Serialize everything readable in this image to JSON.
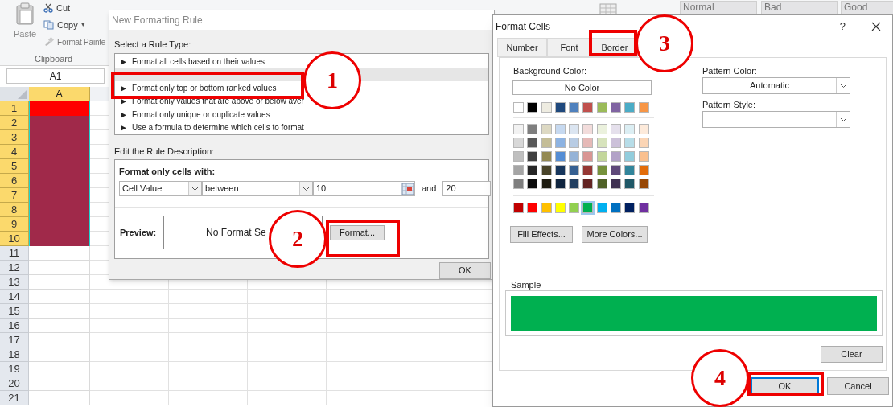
{
  "spreadsheet": {
    "ribbon": {
      "paste": "Paste",
      "cut": "Cut",
      "copy": "Copy",
      "copy_caret": "▾",
      "format_painter": "Format Painte",
      "group_label": "Clipboard",
      "styles": [
        {
          "label": "Normal"
        },
        {
          "label": "Bad"
        },
        {
          "label": "Good"
        }
      ]
    },
    "name_box": "A1",
    "column_header": "A",
    "rows": [
      {
        "number": "1",
        "selected": true,
        "color": "#ff0000"
      },
      {
        "number": "2",
        "selected": true,
        "color": "#a0294a"
      },
      {
        "number": "3",
        "selected": true,
        "color": "#a0294a"
      },
      {
        "number": "4",
        "selected": true,
        "color": "#a0294a"
      },
      {
        "number": "5",
        "selected": true,
        "color": "#a0294a"
      },
      {
        "number": "6",
        "selected": true,
        "color": "#a0294a"
      },
      {
        "number": "7",
        "selected": true,
        "color": "#a0294a"
      },
      {
        "number": "8",
        "selected": true,
        "color": "#a0294a"
      },
      {
        "number": "9",
        "selected": true,
        "color": "#a0294a"
      },
      {
        "number": "10",
        "selected": true,
        "color": "#a0294a"
      },
      {
        "number": "11",
        "selected": false
      },
      {
        "number": "12",
        "selected": false
      },
      {
        "number": "13",
        "selected": false
      },
      {
        "number": "14",
        "selected": false
      },
      {
        "number": "15",
        "selected": false
      },
      {
        "number": "16",
        "selected": false
      },
      {
        "number": "17",
        "selected": false
      },
      {
        "number": "18",
        "selected": false
      },
      {
        "number": "19",
        "selected": false
      },
      {
        "number": "20",
        "selected": false
      },
      {
        "number": "21",
        "selected": false
      }
    ]
  },
  "new_formatting_rule": {
    "title": "New Formatting Rule",
    "select_label": "Select a Rule Type:",
    "rule_types": [
      {
        "label": "Format all cells based on their values",
        "selected": false
      },
      {
        "selected": true
      },
      {
        "label": "Format only top or bottom ranked values",
        "selected": false
      },
      {
        "label": "Format only values that are above or below aver",
        "selected": false
      },
      {
        "label": "Format only unique or duplicate values",
        "selected": false
      },
      {
        "label": "Use a formula to determine which cells to format",
        "selected": false
      }
    ],
    "marker": "►",
    "edit_label": "Edit the Rule Description:",
    "format_label": "Format only cells with:",
    "condition": "Cell Value",
    "operator": "between",
    "value_1": "10",
    "and_label": "and",
    "value_2": "20",
    "preview_label": "Preview:",
    "preview_text": "No Format Se",
    "format_button": "Format...",
    "ok_button": "OK"
  },
  "format_cells": {
    "title": "Format Cells",
    "help": "?",
    "tabs": [
      {
        "label": "Number",
        "selected": false
      },
      {
        "label": "Font",
        "selected": false
      },
      {
        "label": "Border",
        "selected": false
      }
    ],
    "background_color_label": "Background Color:",
    "no_color": "No Color",
    "palette": [
      [
        {
          "color": "#ffffff",
          "selected": false
        },
        {
          "color": "#000000",
          "selected": false
        },
        {
          "color": "#eeece1",
          "selected": false
        },
        {
          "color": "#1f497d",
          "selected": false
        },
        {
          "color": "#4f81bd",
          "selected": false
        },
        {
          "color": "#c0504d",
          "selected": false
        },
        {
          "color": "#9bbb59",
          "selected": false
        },
        {
          "color": "#8064a2",
          "selected": false
        },
        {
          "color": "#4bacc6",
          "selected": false
        },
        {
          "color": "#f79646",
          "selected": false
        }
      ],
      [
        {
          "color": "#f2f2f2",
          "selected": false
        },
        {
          "color": "#7f7f7f",
          "selected": false
        },
        {
          "color": "#ddd9c3",
          "selected": false
        },
        {
          "color": "#c6d9f0",
          "selected": false
        },
        {
          "color": "#dbe5f1",
          "selected": false
        },
        {
          "color": "#f2dcdb",
          "selected": false
        },
        {
          "color": "#ebf1dd",
          "selected": false
        },
        {
          "color": "#e5e0ec",
          "selected": false
        },
        {
          "color": "#dbeef3",
          "selected": false
        },
        {
          "color": "#fdeada",
          "selected": false
        }
      ],
      [
        {
          "color": "#d8d8d8",
          "selected": false
        },
        {
          "color": "#595959",
          "selected": false
        },
        {
          "color": "#c4bd97",
          "selected": false
        },
        {
          "color": "#8db3e2",
          "selected": false
        },
        {
          "color": "#b8cce4",
          "selected": false
        },
        {
          "color": "#e5b9b7",
          "selected": false
        },
        {
          "color": "#d7e3bc",
          "selected": false
        },
        {
          "color": "#ccc1d9",
          "selected": false
        },
        {
          "color": "#b7dde8",
          "selected": false
        },
        {
          "color": "#fbd5b5",
          "selected": false
        }
      ],
      [
        {
          "color": "#bfbfbf",
          "selected": false
        },
        {
          "color": "#3f3f3f",
          "selected": false
        },
        {
          "color": "#938953",
          "selected": false
        },
        {
          "color": "#548dd4",
          "selected": false
        },
        {
          "color": "#95b3d7",
          "selected": false
        },
        {
          "color": "#d99694",
          "selected": false
        },
        {
          "color": "#c3d69b",
          "selected": false
        },
        {
          "color": "#b2a2c7",
          "selected": false
        },
        {
          "color": "#92cddc",
          "selected": false
        },
        {
          "color": "#fac08f",
          "selected": false
        }
      ],
      [
        {
          "color": "#a5a5a5",
          "selected": false
        },
        {
          "color": "#262626",
          "selected": false
        },
        {
          "color": "#494429",
          "selected": false
        },
        {
          "color": "#17365d",
          "selected": false
        },
        {
          "color": "#366092",
          "selected": false
        },
        {
          "color": "#953734",
          "selected": false
        },
        {
          "color": "#76923c",
          "selected": false
        },
        {
          "color": "#5f497a",
          "selected": false
        },
        {
          "color": "#31859b",
          "selected": false
        },
        {
          "color": "#e36c09",
          "selected": false
        }
      ],
      [
        {
          "color": "#7f7f7f",
          "selected": false
        },
        {
          "color": "#0c0c0c",
          "selected": false
        },
        {
          "color": "#1d1b10",
          "selected": false
        },
        {
          "color": "#0f243e",
          "selected": false
        },
        {
          "color": "#244061",
          "selected": false
        },
        {
          "color": "#632423",
          "selected": false
        },
        {
          "color": "#4f6128",
          "selected": false
        },
        {
          "color": "#3f3151",
          "selected": false
        },
        {
          "color": "#205867",
          "selected": false
        },
        {
          "color": "#974806",
          "selected": false
        }
      ],
      [
        {
          "color": "#c00000",
          "selected": false
        },
        {
          "color": "#ff0000",
          "selected": false
        },
        {
          "color": "#ffc000",
          "selected": false
        },
        {
          "color": "#ffff00",
          "selected": false
        },
        {
          "color": "#92d050",
          "selected": false
        },
        {
          "color": "#00b050",
          "selected": true
        },
        {
          "color": "#00b0f0",
          "selected": false
        },
        {
          "color": "#0070c0",
          "selected": false
        },
        {
          "color": "#002060",
          "selected": false
        },
        {
          "color": "#7030a0",
          "selected": false
        }
      ]
    ],
    "fill_effects": "Fill Effects...",
    "more_colors": "More Colors...",
    "pattern_color_label": "Pattern Color:",
    "pattern_color": "Automatic",
    "pattern_style_label": "Pattern Style:",
    "sample_label": "Sample",
    "clear_button": "Clear",
    "ok_button": "OK",
    "cancel_button": "Cancel"
  },
  "annotations": [
    {
      "number": "1"
    },
    {
      "number": "2"
    },
    {
      "number": "3"
    },
    {
      "number": "4"
    }
  ]
}
